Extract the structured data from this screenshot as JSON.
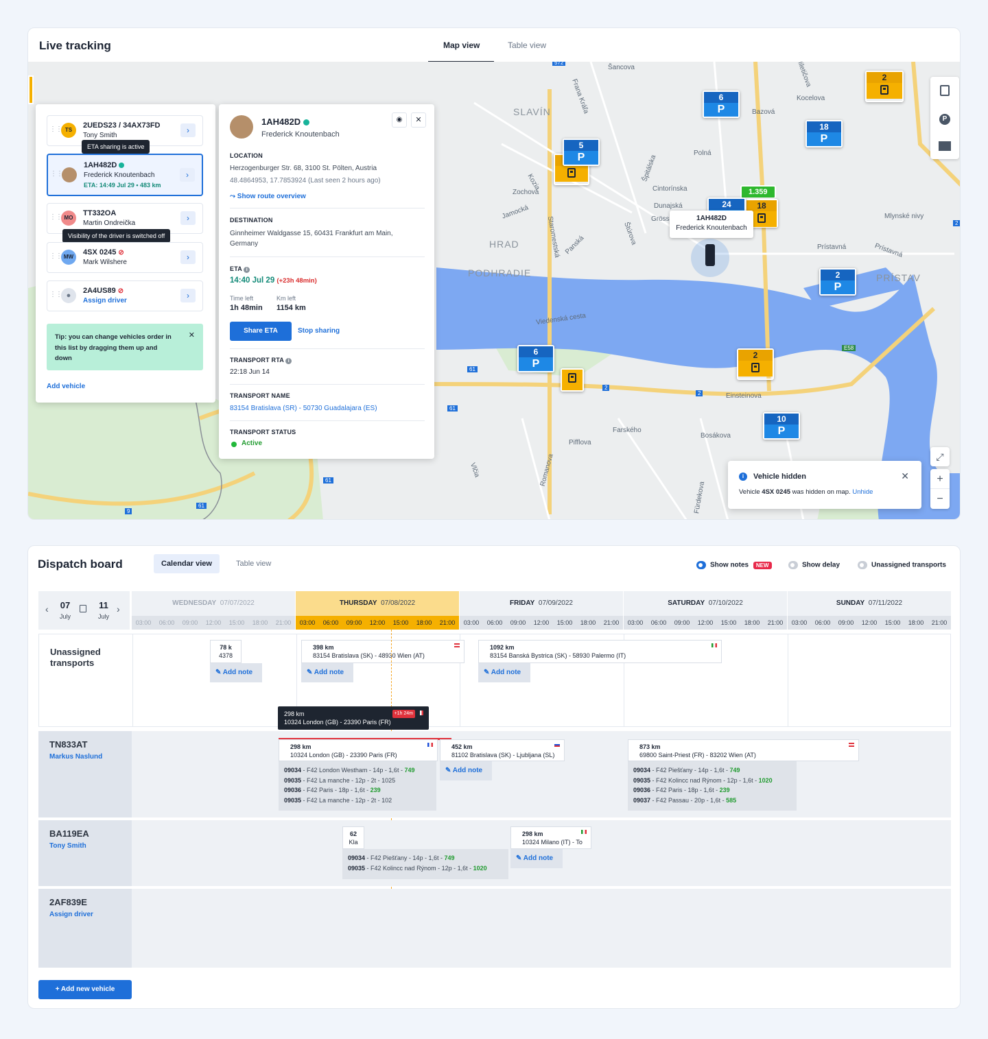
{
  "live": {
    "title": "Live tracking",
    "tabs": [
      "Map view",
      "Table view"
    ],
    "vehicles": [
      {
        "plate": "2UEDS23 / 34AX73FD",
        "driver": "Tony Smith",
        "initials": "TS",
        "avatar_color": "#f5b000"
      },
      {
        "plate": "1AH482D",
        "driver": "Frederick Knoutenbach",
        "eta": "ETA: 14:49 Jul 29 • 483 km"
      },
      {
        "plate": "TT332OA",
        "driver": "Martin Ondreička",
        "initials": "MO",
        "avatar_color": "#f08a8a"
      },
      {
        "plate": "4SX 0245",
        "driver": "Mark Wilshere",
        "initials": "MW",
        "avatar_color": "#6fa8f0"
      },
      {
        "plate": "2A4US89",
        "driver": "Assign driver"
      }
    ],
    "tooltip_eta": "ETA sharing is active",
    "tooltip_visibility": "Visibility of the driver is switched off",
    "tip": "Tip: you can change vehicles order in this list by dragging them up and down",
    "add_vehicle": "Add vehicle",
    "detail": {
      "plate": "1AH482D",
      "driver": "Frederick Knoutenbach",
      "location_label": "LOCATION",
      "location": "Herzogenburger Str. 68, 3100 St. Pölten, Austria",
      "coords": "48.4864953, 17.7853924  (Last seen 2 hours ago)",
      "route_link": "Show route overview",
      "destination_label": "DESTINATION",
      "destination": "Ginnheimer Waldgasse 15, 60431 Frankfurt am Main, Germany",
      "eta_label": "ETA",
      "eta": "14:40 Jul 29",
      "eta_delay": "(+23h 48min)",
      "time_left_label": "Time left",
      "time_left": "1h 48min",
      "km_left_label": "Km left",
      "km_left": "1154 km",
      "share_eta": "Share ETA",
      "stop_sharing": "Stop sharing",
      "rta_label": "TRANSPORT RTA",
      "rta": "22:18 Jun 14",
      "name_label": "TRANSPORT NAME",
      "name": "83154 Bratislava (SR) - 50730 Guadalajara (ES)",
      "status_label": "TRANSPORT STATUS",
      "status": "Active"
    },
    "map": {
      "labels": [
        "SLAVÍN",
        "HRAD",
        "PODHRADIE",
        "PRÍSTAV",
        "Šancova",
        "Miletičova",
        "Kocelova",
        "Bazová",
        "Frana Kráľa",
        "Špitálska",
        "Cintorínska",
        "Dunajská",
        "Grössl",
        "Štúrova",
        "Panská",
        "Staromestská",
        "Kozia",
        "Zochova",
        "Jamocká",
        "Polná",
        "Mlynské nivy",
        "Prístavná",
        "Prístavná",
        "Viedenská cesta",
        "Einsteinova",
        "Bosákova",
        "Farského",
        "Pifflova",
        "Vlčia",
        "Romanova",
        "Fürdekova",
        "E58",
        "61",
        "61",
        "61",
        "61",
        "2",
        "2",
        "2",
        "2",
        "9",
        "572"
      ],
      "pins": [
        {
          "type": "park",
          "count": "6"
        },
        {
          "type": "park",
          "count": "5"
        },
        {
          "type": "park",
          "count": "18"
        },
        {
          "type": "park",
          "count": "24"
        },
        {
          "type": "park",
          "count": "2"
        },
        {
          "type": "park",
          "count": "6"
        },
        {
          "type": "park",
          "count": "10"
        },
        {
          "type": "fuel",
          "count": "2"
        },
        {
          "type": "fuel",
          "count": "18"
        },
        {
          "type": "fuel",
          "count": "2"
        }
      ],
      "price_tag": "1.359",
      "park_letter": "P",
      "vehicle_label_plate": "1AH482D",
      "vehicle_label_driver": "Frederick Knoutenbach"
    },
    "toast": {
      "title": "Vehicle hidden",
      "pre": "Vehicle ",
      "plate": "4SX 0245",
      "post": " was hidden on map. ",
      "link": "Unhide"
    },
    "controls": {
      "fullscreen": "⤢",
      "zoom_in": "+",
      "zoom_out": "−"
    }
  },
  "dispatch": {
    "title": "Dispatch board",
    "tabs": [
      "Calendar view",
      "Table view"
    ],
    "toggles": {
      "notes": "Show notes",
      "new_badge": "NEW",
      "delay": "Show delay",
      "unassigned": "Unassigned transports"
    },
    "range": {
      "start_day": "07",
      "start_month": "July",
      "end_day": "11",
      "end_month": "July"
    },
    "days": [
      {
        "name": "WEDNESDAY",
        "date": "07/07/2022"
      },
      {
        "name": "THURSDAY",
        "date": "07/08/2022"
      },
      {
        "name": "FRIDAY",
        "date": "07/09/2022"
      },
      {
        "name": "SATURDAY",
        "date": "07/10/2022"
      },
      {
        "name": "SUNDAY",
        "date": "07/11/2022"
      }
    ],
    "hours": [
      "03:00",
      "06:00",
      "09:00",
      "12:00",
      "15:00",
      "18:00",
      "21:00"
    ],
    "rows": {
      "unassigned": "Unassigned transports",
      "r1": {
        "plate": "TN833AT",
        "driver": "Markus Naslund"
      },
      "r2": {
        "plate": "BA119EA",
        "driver": "Tony Smith"
      },
      "r3": {
        "plate": "2AF839E",
        "driver": "Assign driver"
      }
    },
    "add_note": "Add note",
    "transports": {
      "u1_km": "78 k",
      "u1_route": "4378",
      "u2_km": "398 km",
      "u2_route": "83154 Bratislava (SK) - 48930 Wien (AT)",
      "u3_km": "1092 km",
      "u3_route": "83154 Banská Bystrica (SK) - 58930 Palermo (IT)",
      "hover_km": "298 km",
      "hover_route": "10324 London (GB) - 23390 Paris (FR)",
      "hover_delay": "+1h 24m",
      "t1_km": "298 km",
      "t1_route": "10324 London (GB) - 23390 Paris (FR)",
      "t2_km": "452 km",
      "t2_route": "81102 Bratislava (SK) - Ljubljana (SL)",
      "t3_km": "873 km",
      "t3_route": "69800 Saint-Priest (FR) - 83202 Wien (AT)",
      "b1_km": "62",
      "b1_route": "Kla",
      "b2_km": "298 km",
      "b2_route": "10324 Milano (IT) - To"
    },
    "orders_t1": [
      {
        "id": "09034",
        "text": " - F42 London Westham - 14p - 1,6t - ",
        "num": "749",
        "green": true
      },
      {
        "id": "09035",
        "text": " - F42 La manche - 12p - 2t - 1025",
        "num": "",
        "green": false
      },
      {
        "id": "09036",
        "text": " - F42 Paris - 18p - 1,6t - ",
        "num": "239",
        "green": true
      },
      {
        "id": "09035",
        "text": " - F42 La manche - 12p - 2t - 102",
        "num": "",
        "green": false
      }
    ],
    "orders_t3": [
      {
        "id": "09034",
        "text": " - F42 Piešťany - 14p - 1,6t - ",
        "num": "749"
      },
      {
        "id": "09035",
        "text": " - F42 Kolincc nad Rýnom - 12p - 1,6t - ",
        "num": "1020"
      },
      {
        "id": "09036",
        "text": " - F42 Paris - 18p - 1,6t - ",
        "num": "239"
      },
      {
        "id": "09037",
        "text": " - F42 Passau - 20p - 1,6t - ",
        "num": "585"
      }
    ],
    "orders_b1": [
      {
        "id": "09034",
        "text": " - F42 Piešťany - 14p - 1,6t - ",
        "num": "749"
      },
      {
        "id": "09035",
        "text": " - F42 Kolincc nad Rýnom - 12p - 1,6t - ",
        "num": "1020"
      }
    ],
    "add_vehicle": "+  Add new vehicle"
  }
}
